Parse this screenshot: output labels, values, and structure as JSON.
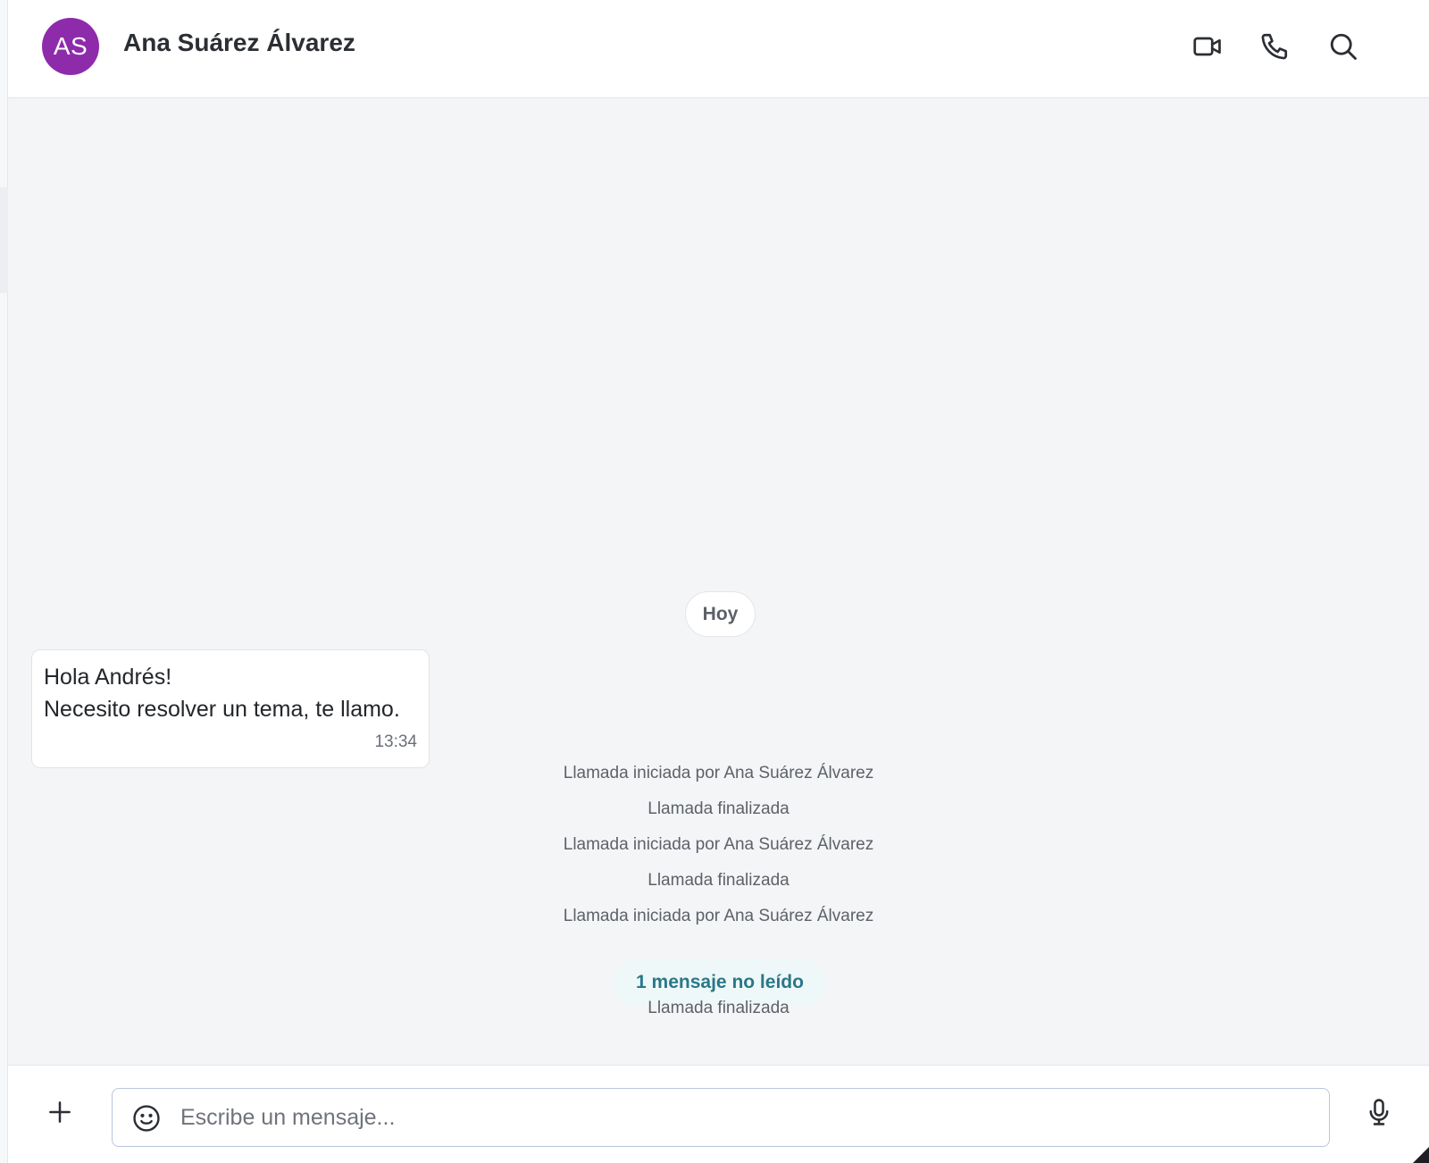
{
  "header": {
    "avatar_initials": "AS",
    "avatar_color": "#8e2bab",
    "contact_name": "Ana Suárez Álvarez",
    "actions": [
      {
        "icon": "video-camera-icon"
      },
      {
        "icon": "phone-icon"
      },
      {
        "icon": "search-icon"
      }
    ]
  },
  "chat": {
    "date_separator": "Hoy",
    "message": {
      "line1": "Hola Andrés!",
      "line2": "Necesito resolver un tema, te llamo.",
      "time": "13:34"
    },
    "events": [
      "Llamada iniciada por Ana Suárez Álvarez",
      "Llamada finalizada",
      "Llamada iniciada por Ana Suárez Álvarez",
      "Llamada finalizada",
      "Llamada iniciada por Ana Suárez Álvarez"
    ],
    "unread_badge": "1 mensaje no leído",
    "last_event": "Llamada finalizada",
    "accent_color": "#2b7788"
  },
  "composer": {
    "add_icon": "plus-icon",
    "emoji_icon": "smiley-icon",
    "placeholder": "Escribe un mensaje...",
    "value": "",
    "mic_icon": "microphone-icon"
  }
}
